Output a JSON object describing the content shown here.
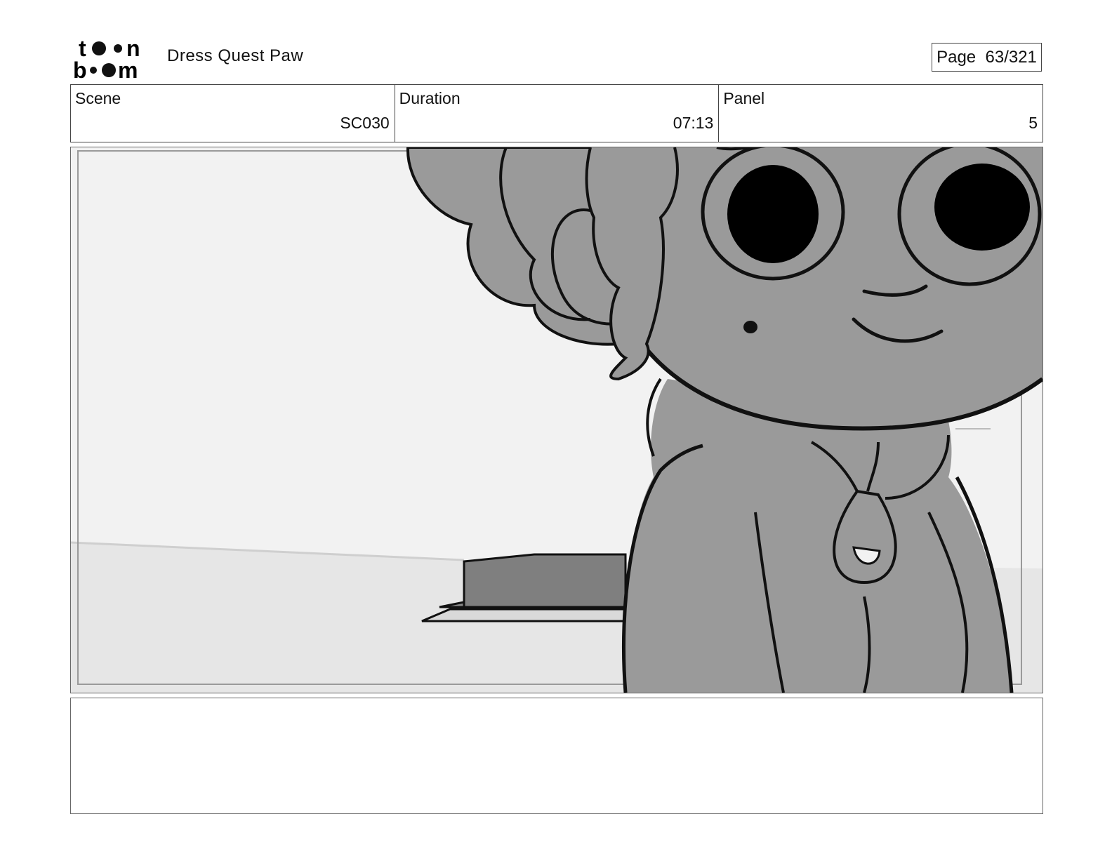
{
  "header": {
    "logo_text": "toon boom",
    "project_title": "Dress Quest Paw",
    "page_label": "Page",
    "page_value": "63/321"
  },
  "info": {
    "scene_label": "Scene",
    "scene_value": "SC030",
    "duration_label": "Duration",
    "duration_value": "07:13",
    "panel_label": "Panel",
    "panel_value": "5"
  },
  "notes": {
    "text": ""
  }
}
